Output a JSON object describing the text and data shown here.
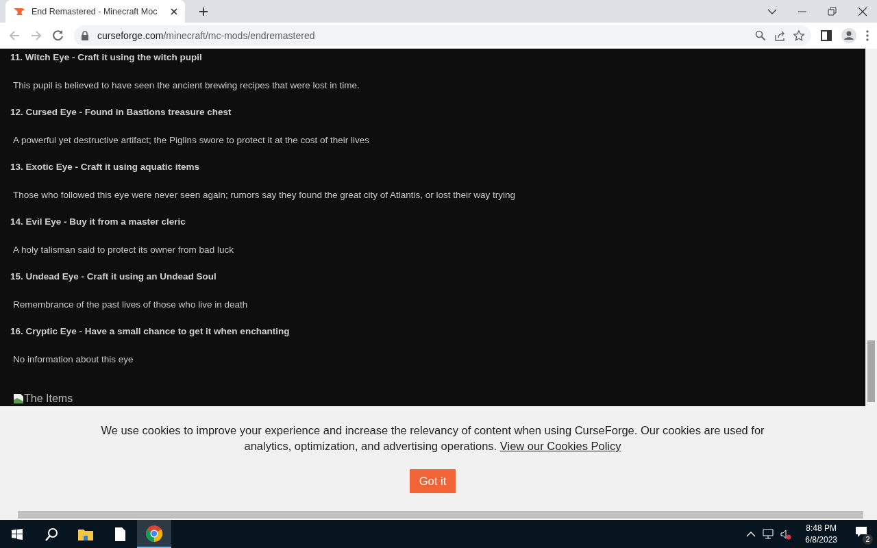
{
  "browser": {
    "tab": {
      "title": "End Remastered - Minecraft Moc",
      "selected": true
    },
    "url_host": "curseforge.com",
    "url_path": "/minecraft/mc-mods/endremastered"
  },
  "article": {
    "entries": [
      {
        "heading": "11. Witch Eye - Craft it using the witch pupil",
        "description": "This pupil is believed to have seen the ancient brewing recipes that were lost in time."
      },
      {
        "heading": "12. Cursed Eye - Found in Bastions treasure chest",
        "description": "A powerful yet destructive artifact; the Piglins swore to protect it at the cost of their lives"
      },
      {
        "heading": "13. Exotic Eye - Craft it using aquatic items",
        "description": "Those who followed this eye were never seen again; rumors say they found the great city of Atlantis, or lost their way trying"
      },
      {
        "heading": "14. Evil Eye - Buy it from a master cleric",
        "description": "A holy talisman said to protect its owner from bad luck"
      },
      {
        "heading": "15. Undead Eye - Craft it using an Undead Soul",
        "description": "Remembrance of the past lives of those who live in death"
      },
      {
        "heading": "16. Cryptic Eye - Have a small chance to get it when enchanting",
        "description": "No information about this eye"
      }
    ],
    "image_alt": "The Items"
  },
  "cookie_banner": {
    "message": "We use cookies to improve your experience and increase the relevancy of content when using CurseForge. Our cookies are used for analytics, optimization, and advertising operations.",
    "link": "View our Cookies Policy",
    "button": "Got it"
  },
  "taskbar": {
    "time": "8:48 PM",
    "date": "6/8/2023",
    "notification_count": "2"
  }
}
